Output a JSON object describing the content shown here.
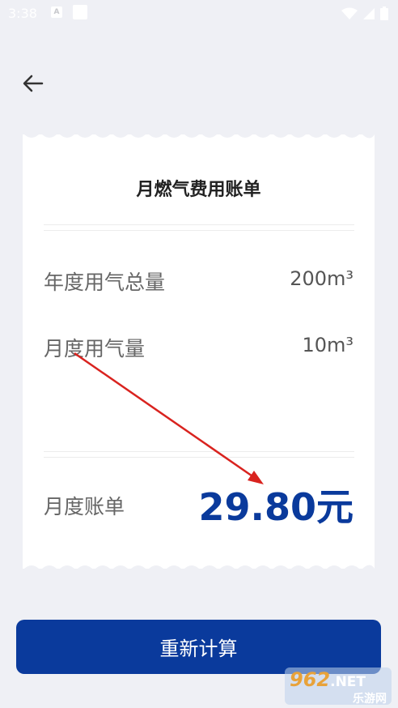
{
  "status_bar": {
    "time": "3:38",
    "app_icon_letter": "A"
  },
  "header": {
    "back_icon": "arrow-left-icon"
  },
  "receipt": {
    "title": "月燃气费用账单",
    "rows": [
      {
        "label": "年度用气总量",
        "value": "200m³"
      },
      {
        "label": "月度用气量",
        "value": "10m³"
      }
    ],
    "bill": {
      "label": "月度账单",
      "value": "29.80元"
    }
  },
  "action": {
    "recalculate_label": "重新计算"
  },
  "watermark": {
    "brand": "962",
    "suffix": ".NET",
    "subtitle": "乐游网"
  },
  "colors": {
    "accent": "#0a3a9c",
    "background": "#eff0f5",
    "annotation_arrow": "#d9231f"
  }
}
